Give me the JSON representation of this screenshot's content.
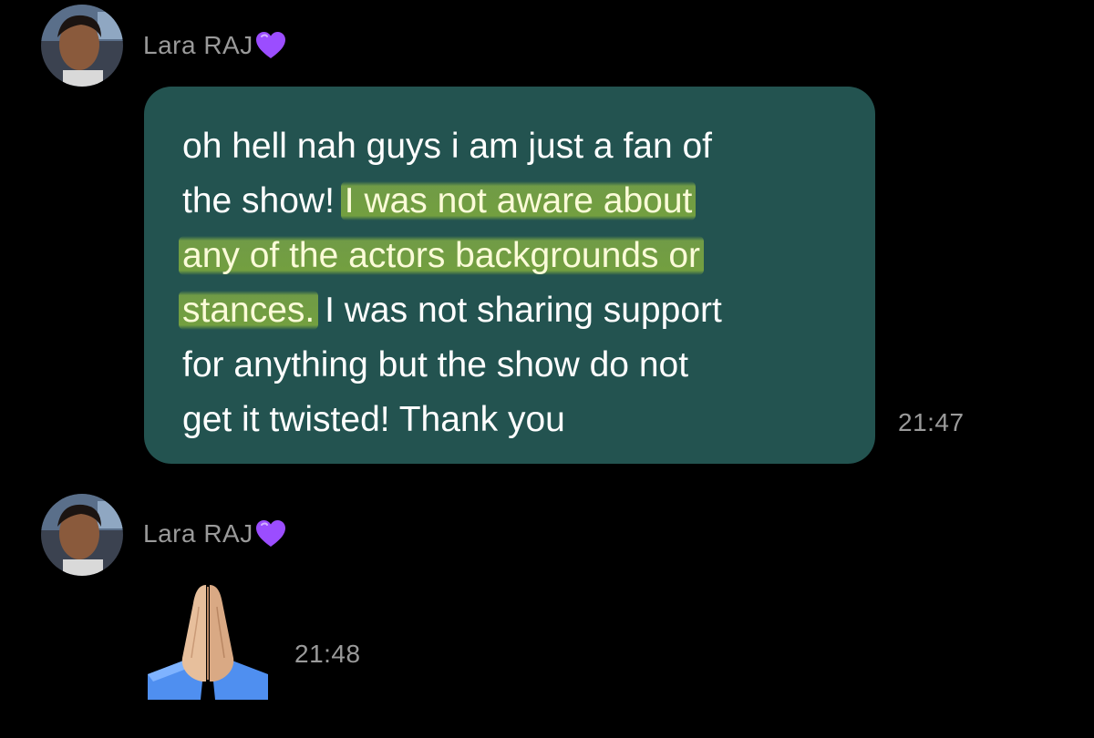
{
  "messages": [
    {
      "sender": "Lara RAJ",
      "lines": [
        [
          {
            "text": "oh hell nah guys i am just a fan of",
            "hl": false
          }
        ],
        [
          {
            "text": "the show! ",
            "hl": false
          },
          {
            "text": "I was not aware about",
            "hl": true
          }
        ],
        [
          {
            "text": "any of the actors backgrounds or",
            "hl": true
          }
        ],
        [
          {
            "text": "stances.",
            "hl": true
          },
          {
            "text": " I was not sharing support",
            "hl": false
          }
        ],
        [
          {
            "text": "for anything but the show do not",
            "hl": false
          }
        ],
        [
          {
            "text": "get it twisted! Thank you",
            "hl": false
          }
        ]
      ],
      "time": "21:47"
    },
    {
      "sender": "Lara RAJ",
      "emoji": "folded-hands-icon",
      "time": "21:48"
    }
  ],
  "colors": {
    "background": "#000000",
    "bubble": "#235350",
    "meta_text": "#9a9a9a",
    "highlight": "#b4d63e",
    "heart": "#9b4dff"
  }
}
